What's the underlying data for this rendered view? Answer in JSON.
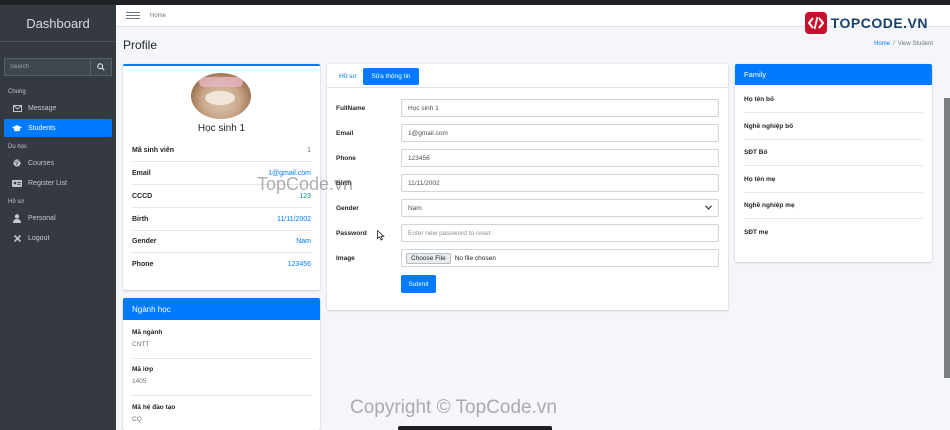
{
  "sidebar": {
    "brand": "Dashboard",
    "search_placeholder": "Search",
    "sections": [
      {
        "header": "Chung",
        "items": [
          {
            "label": "Message",
            "icon": "envelope-icon"
          },
          {
            "label": "Students",
            "icon": "graduation-cap-icon",
            "active": true
          }
        ]
      },
      {
        "header": "Du học",
        "items": [
          {
            "label": "Courses",
            "icon": "globe-icon"
          },
          {
            "label": "Register List",
            "icon": "id-card-icon"
          }
        ]
      },
      {
        "header": "Hồ sơ",
        "items": [
          {
            "label": "Personal",
            "icon": "user-icon"
          },
          {
            "label": "Logout",
            "icon": "close-icon"
          }
        ]
      }
    ]
  },
  "header": {
    "home_link": "Home",
    "logo_text": "TOPCODE.VN"
  },
  "page": {
    "title": "Profile",
    "breadcrumb": {
      "home": "Home",
      "separator": "/",
      "current": "View Student"
    }
  },
  "profile": {
    "name": "Học sinh 1",
    "rows": [
      {
        "label": "Mã sinh viên",
        "value": "1"
      },
      {
        "label": "Email",
        "value": "1@gmail.com"
      },
      {
        "label": "CCCD",
        "value": "123"
      },
      {
        "label": "Birth",
        "value": "11/11/2002"
      },
      {
        "label": "Gender",
        "value": "Nam"
      },
      {
        "label": "Phone",
        "value": "123456"
      }
    ]
  },
  "major": {
    "title": "Ngành học",
    "items": [
      {
        "label": "Mã ngành",
        "value": "CNTT"
      },
      {
        "label": "Mã lớp",
        "value": "1405"
      },
      {
        "label": "Mã hệ đào tạo",
        "value": "CQ"
      }
    ]
  },
  "form": {
    "tabs": [
      {
        "label": "Hồ sơ"
      },
      {
        "label": "Sửa thông tin",
        "active": true
      }
    ],
    "fields": {
      "fullname": {
        "label": "FullName",
        "value": "Học sinh 1"
      },
      "email": {
        "label": "Email",
        "value": "1@gmail.com"
      },
      "phone": {
        "label": "Phone",
        "value": "123456"
      },
      "birth": {
        "label": "Birth",
        "value": "11/11/2002"
      },
      "gender": {
        "label": "Gender",
        "value": "Nam"
      },
      "password": {
        "label": "Password",
        "placeholder": "Enter new password to reset"
      },
      "image": {
        "label": "Image",
        "button": "Choose File",
        "status": "No file chosen"
      }
    },
    "submit": "Submit"
  },
  "family": {
    "title": "Family",
    "rows": [
      {
        "label": "Họ tên bố"
      },
      {
        "label": "Nghề nghiệp bố"
      },
      {
        "label": "SĐT Bố"
      },
      {
        "label": "Họ tên mẹ"
      },
      {
        "label": "Nghề nghiệp mẹ"
      },
      {
        "label": "SĐT mẹ"
      }
    ]
  },
  "watermarks": {
    "mid": "TopCode.vn",
    "bottom": "Copyright © TopCode.vn"
  },
  "colors": {
    "primary": "#007bff",
    "sidebar": "#343a40",
    "background": "#f4f6f9"
  }
}
